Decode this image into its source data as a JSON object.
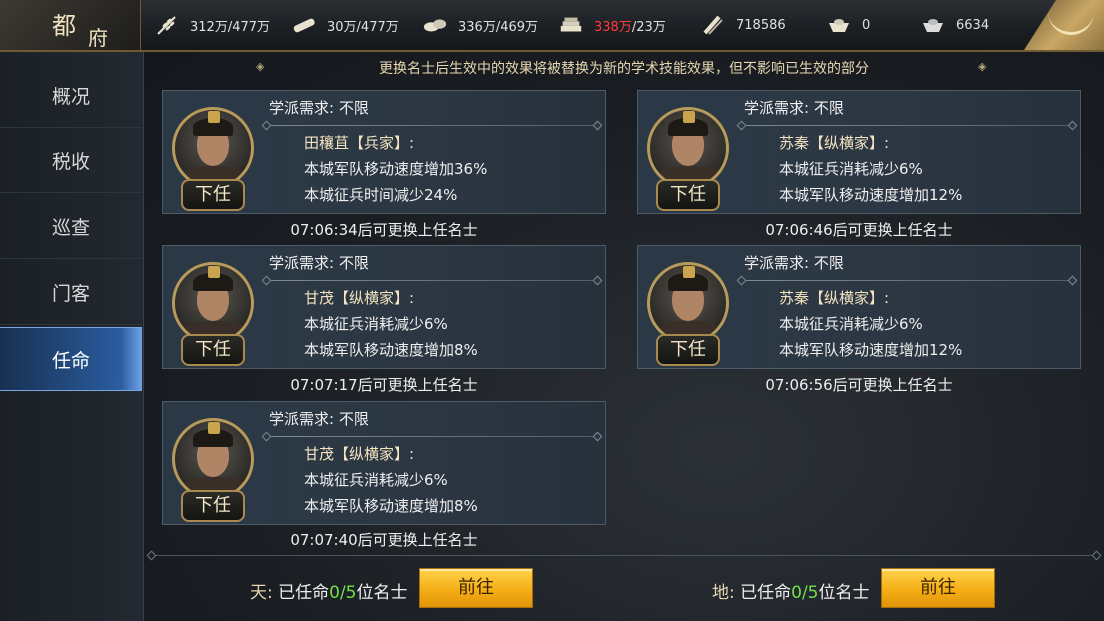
{
  "header": {
    "title_char1": "都",
    "title_char2": "府",
    "resources": [
      {
        "icon": "grain-icon",
        "value": "312万/477万",
        "highlight": false
      },
      {
        "icon": "lumber-icon",
        "value": "30万/477万",
        "highlight": false
      },
      {
        "icon": "stone-icon",
        "value": "336万/469万",
        "highlight": false
      },
      {
        "icon": "iron-icon",
        "value": "338万",
        "suffix": "/23万",
        "highlight": true
      },
      {
        "icon": "scroll-icon",
        "value": "718586",
        "highlight": false
      },
      {
        "icon": "gold-ingot-icon",
        "value": "0",
        "highlight": false
      },
      {
        "icon": "silver-ingot-icon",
        "value": "6634",
        "highlight": false
      }
    ]
  },
  "sidebar": {
    "items": [
      {
        "label": "概况",
        "active": false
      },
      {
        "label": "税收",
        "active": false
      },
      {
        "label": "巡查",
        "active": false
      },
      {
        "label": "门客",
        "active": false
      },
      {
        "label": "任命",
        "active": true
      }
    ]
  },
  "notice": "更换名士后生效中的效果将被替换为新的学术技能效果，但不影响已生效的部分",
  "cards": [
    {
      "school": "学派需求:  不限",
      "name": "田穰苴【兵家】:",
      "effect1": "本城军队移动速度增加36%",
      "effect2": "本城征兵时间减少24%",
      "button": "下任",
      "timer": "07:06:34后可更换上任名士"
    },
    {
      "school": "学派需求:  不限",
      "name": "苏秦【纵横家】:",
      "effect1": "本城征兵消耗减少6%",
      "effect2": "本城军队移动速度增加12%",
      "button": "下任",
      "timer": "07:06:46后可更换上任名士"
    },
    {
      "school": "学派需求:  不限",
      "name": "甘茂【纵横家】:",
      "effect1": "本城征兵消耗减少6%",
      "effect2": "本城军队移动速度增加8%",
      "button": "下任",
      "timer": "07:07:17后可更换上任名士"
    },
    {
      "school": "学派需求:  不限",
      "name": "苏秦【纵横家】:",
      "effect1": "本城征兵消耗减少6%",
      "effect2": "本城军队移动速度增加12%",
      "button": "下任",
      "timer": "07:06:56后可更换上任名士"
    },
    {
      "school": "学派需求:  不限",
      "name": "甘茂【纵横家】:",
      "effect1": "本城征兵消耗减少6%",
      "effect2": "本城军队移动速度增加8%",
      "button": "下任",
      "timer": "07:07:40后可更换上任名士"
    }
  ],
  "bottom": {
    "heaven": {
      "label": "天:",
      "pre": "已任命",
      "count": "0/5",
      "post": "位名士",
      "button": "前往"
    },
    "earth": {
      "label": "地:",
      "pre": "已任命",
      "count": "0/5",
      "post": "位名士",
      "button": "前往"
    }
  },
  "colors": {
    "accent_gold": "#c9a764",
    "active_blue": "#2a5da0",
    "count_green": "#6fe04a",
    "warning_red": "#ff3b3b",
    "button_orange": "#f5ae15"
  }
}
